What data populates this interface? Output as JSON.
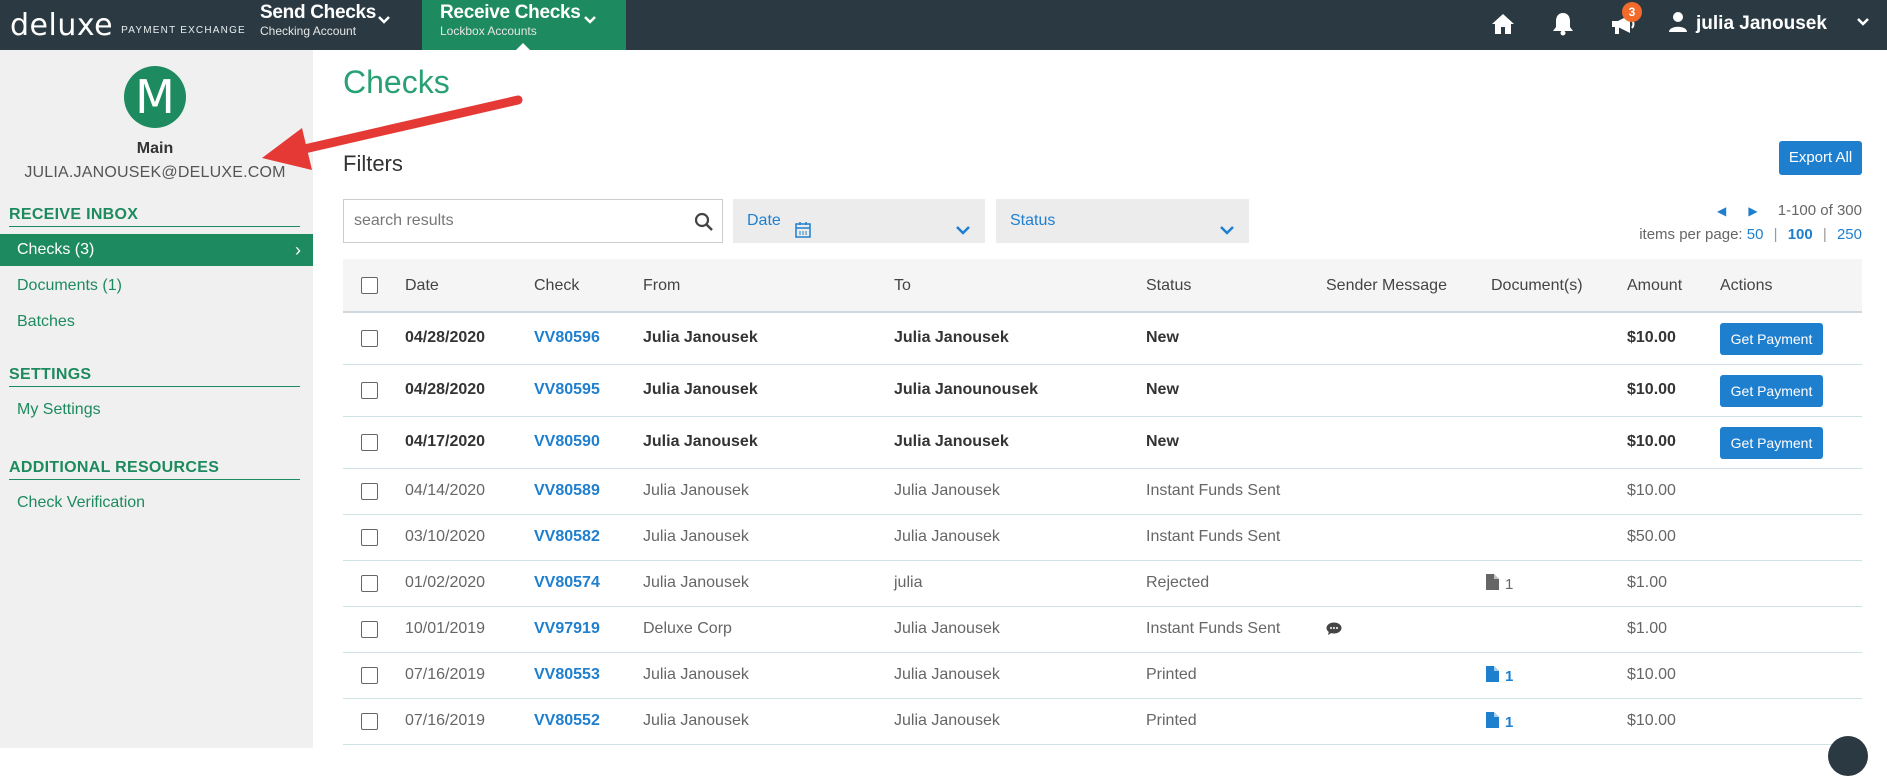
{
  "topbar": {
    "brand": "deluxe",
    "brand_sub": "PAYMENT EXCHANGE",
    "send": {
      "title": "Send Checks",
      "sub": "Checking Account"
    },
    "receive": {
      "title": "Receive Checks",
      "sub": "Lockbox Accounts"
    },
    "notifications_count": "3",
    "user_name": "julia Janousek",
    "icons": [
      "home-icon",
      "bell-icon",
      "megaphone-icon",
      "user-icon"
    ]
  },
  "sidebar": {
    "avatar_letter": "M",
    "account_name": "Main",
    "account_email": "JULIA.JANOUSEK@DELUXE.COM",
    "sections": {
      "receive_inbox": "RECEIVE INBOX",
      "settings": "SETTINGS",
      "additional": "ADDITIONAL RESOURCES"
    },
    "links": {
      "checks": "Checks (3)",
      "documents": "Documents (1)",
      "batches": "Batches",
      "my_settings": "My Settings",
      "check_verification": "Check Verification"
    }
  },
  "main": {
    "title": "Checks",
    "filters_label": "Filters",
    "export_label": "Export All",
    "search_placeholder": "search results",
    "date_filter": "Date",
    "status_filter": "Status",
    "pagination": {
      "range": "1-100 of 300",
      "items_per_page_label": "items per page:",
      "options": [
        "50",
        "100",
        "250"
      ],
      "selected": "100"
    },
    "columns": [
      "Date",
      "Check",
      "From",
      "To",
      "Status",
      "Sender Message",
      "Document(s)",
      "Amount",
      "Actions"
    ],
    "action_label": "Get Payment",
    "rows": [
      {
        "date": "04/28/2020",
        "check": "VV80596",
        "from": "Julia Janousek",
        "to": "Julia Janousek",
        "status": "New",
        "message": "",
        "docs": "",
        "amount": "$10.00",
        "unread": true
      },
      {
        "date": "04/28/2020",
        "check": "VV80595",
        "from": "Julia Janousek",
        "to": "Julia Janounousek",
        "status": "New",
        "message": "",
        "docs": "",
        "amount": "$10.00",
        "unread": true
      },
      {
        "date": "04/17/2020",
        "check": "VV80590",
        "from": "Julia Janousek",
        "to": "Julia Janousek",
        "status": "New",
        "message": "",
        "docs": "",
        "amount": "$10.00",
        "unread": true
      },
      {
        "date": "04/14/2020",
        "check": "VV80589",
        "from": "Julia Janousek",
        "to": "Julia Janousek",
        "status": "Instant Funds Sent",
        "message": "",
        "docs": "",
        "amount": "$10.00",
        "unread": false
      },
      {
        "date": "03/10/2020",
        "check": "VV80582",
        "from": "Julia Janousek",
        "to": "Julia Janousek",
        "status": "Instant Funds Sent",
        "message": "",
        "docs": "",
        "amount": "$50.00",
        "unread": false
      },
      {
        "date": "01/02/2020",
        "check": "VV80574",
        "from": "Julia Janousek",
        "to": "julia",
        "status": "Rejected",
        "message": "",
        "docs": "1",
        "docs_style": "gray",
        "amount": "$1.00",
        "unread": false
      },
      {
        "date": "10/01/2019",
        "check": "VV97919",
        "from": "Deluxe Corp",
        "to": "Julia Janousek",
        "status": "Instant Funds Sent",
        "message": "comment-icon",
        "docs": "",
        "amount": "$1.00",
        "unread": false
      },
      {
        "date": "07/16/2019",
        "check": "VV80553",
        "from": "Julia Janousek",
        "to": "Julia Janousek",
        "status": "Printed",
        "message": "",
        "docs": "1",
        "docs_style": "blue",
        "amount": "$10.00",
        "unread": false
      },
      {
        "date": "07/16/2019",
        "check": "VV80552",
        "from": "Julia Janousek",
        "to": "Julia Janousek",
        "status": "Printed",
        "message": "",
        "docs": "1",
        "docs_style": "blue",
        "amount": "$10.00",
        "unread": false
      }
    ]
  },
  "colors": {
    "topbar": "#2b3a42",
    "brand_green": "#1d8a5f",
    "link_blue": "#1f7fcf",
    "annotation_red": "#e53935"
  }
}
